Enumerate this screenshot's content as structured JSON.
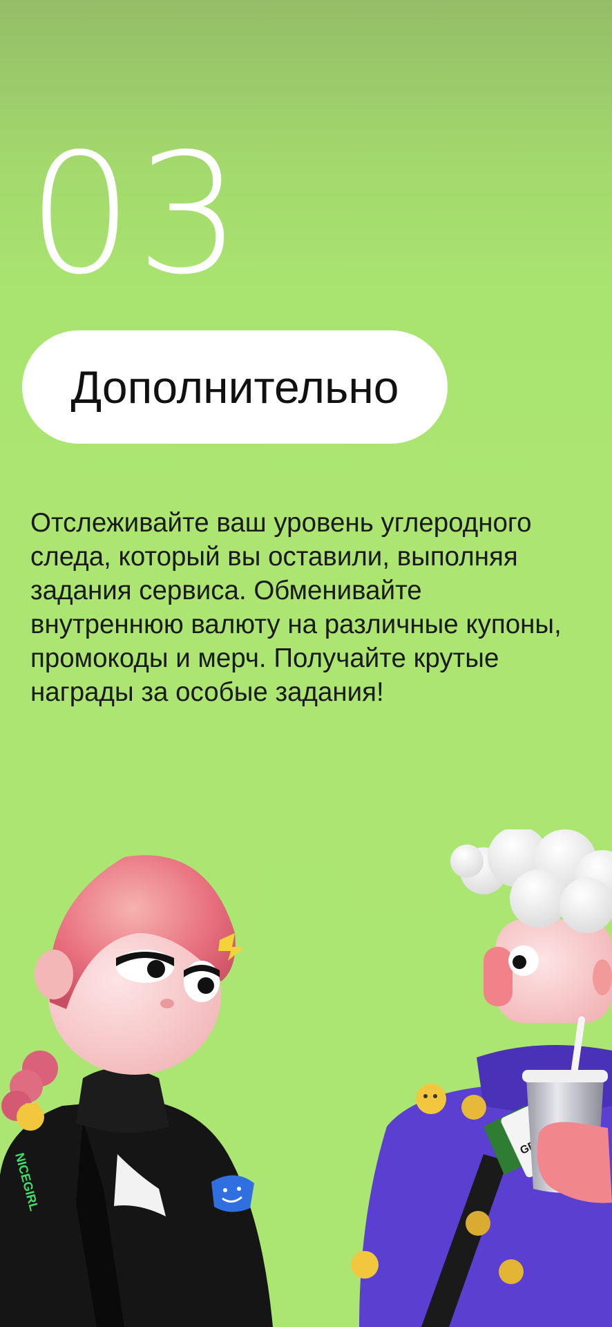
{
  "step": {
    "number": "03"
  },
  "section": {
    "title": "Дополнительно"
  },
  "description": {
    "text": "Отслеживайте ваш уровень углеродного следа, который вы оставили, выполняя задания сервиса. Обменивайте внутреннюю валюту на различные купоны, промокоды и мерч. Получайте крутые награды за особые задания!"
  },
  "illustration": {
    "left_character_jacket_text": "NICEGIRL",
    "right_character_badge_text": "GEO"
  },
  "colors": {
    "background_top": "#93bd67",
    "background_main": "#ace572",
    "pill_background": "#ffffff",
    "number_color": "#ffffff",
    "text_color": "#1a1a1a",
    "sweater_purple": "#5a3fd1",
    "girl_hair_pink": "#e8707f",
    "jacket_black": "#151515"
  }
}
